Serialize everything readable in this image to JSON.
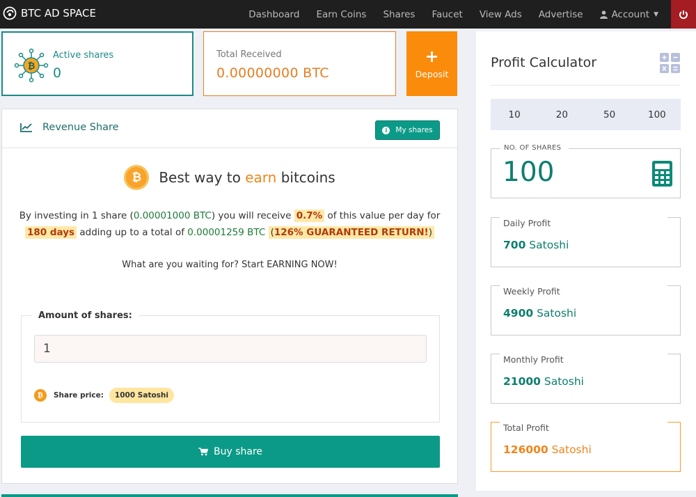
{
  "nav": {
    "brand": "BTC AD SPACE",
    "links": [
      {
        "label": "Dashboard"
      },
      {
        "label": "Earn Coins"
      },
      {
        "label": "Shares"
      },
      {
        "label": "Faucet"
      },
      {
        "label": "View Ads"
      },
      {
        "label": "Advertise"
      }
    ],
    "account_label": "Account"
  },
  "cards": {
    "active_label": "Active shares",
    "active_value": "0",
    "received_label": "Total Received",
    "received_value": "0.00000000 BTC",
    "deposit_label": "Deposit"
  },
  "revenue": {
    "title": "Revenue Share",
    "my_shares": "My shares",
    "headline_pre": "Best way to",
    "headline_accent": "earn",
    "headline_post": "bitcoins",
    "desc": {
      "p1": "By investing in 1 share (",
      "share_btc": "0.00001000 BTC",
      "p2": ") you will receive",
      "rate": "0.7%",
      "p3": "of this value per day for",
      "days": "180 days",
      "p4": "adding up to a total of",
      "total_btc": "0.00001259 BTC",
      "ret_open": "(",
      "ret_bold": "126% GUARANTEED RETURN!",
      "ret_close": ")"
    },
    "waiting": "What are you waiting for? Start EARNING NOW!",
    "amount_label": "Amount of shares:",
    "amount_value": "1",
    "price_label": "Share price:",
    "price_value": "1000 Satoshi",
    "buy_label": "Buy share"
  },
  "calculator": {
    "title": "Profit Calculator",
    "presets": [
      "10",
      "20",
      "50",
      "100"
    ],
    "shares_label": "NO. OF SHARES",
    "shares_value": "100",
    "unit": "Satoshi",
    "daily_label": "Daily Profit",
    "daily_value": "700",
    "weekly_label": "Weekly Profit",
    "weekly_value": "4900",
    "monthly_label": "Monthly Profit",
    "monthly_value": "21000",
    "total_label": "Total Profit",
    "total_value": "126000"
  },
  "colors": {
    "teal": "#0c9a88",
    "orange": "#f0851c",
    "nav_bg": "#1f1f1f",
    "power": "#a31d22"
  },
  "icons": {
    "brand": "bitcoin-logo-icon",
    "account": "user-icon",
    "power": "power-icon",
    "active": "bitcoin-network-icon",
    "deposit": "plus-icon",
    "revenue": "line-chart-icon",
    "my_shares": "info-icon",
    "coin": "bitcoin-coin-icon",
    "buy": "cart-icon",
    "calculator": "calculator-icon"
  }
}
